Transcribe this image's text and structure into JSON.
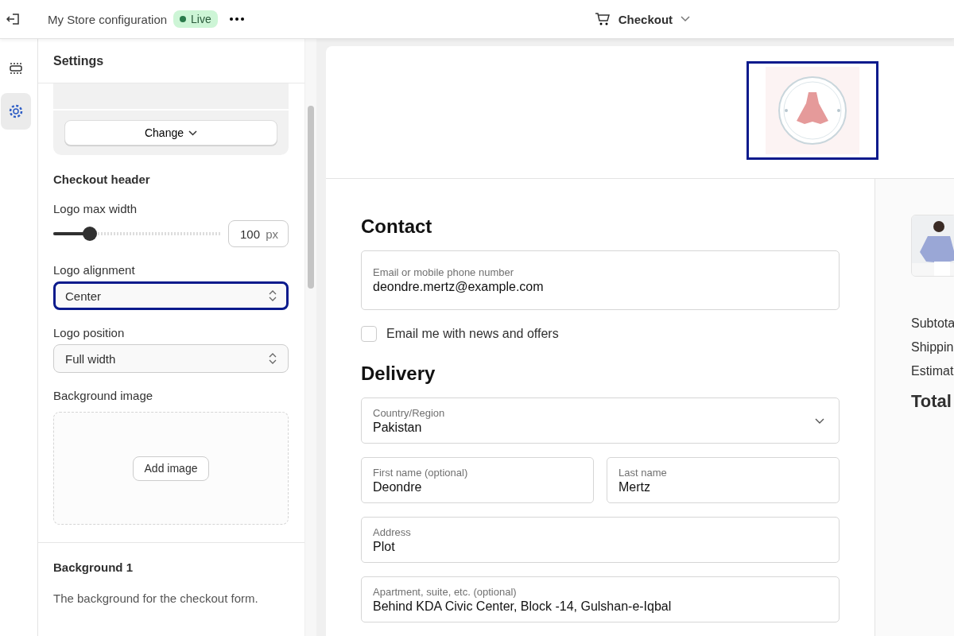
{
  "topbar": {
    "title": "My Store configuration",
    "status": "Live",
    "page": "Checkout"
  },
  "rail": [
    {
      "kind": "sections",
      "selected": false
    },
    {
      "kind": "settings",
      "selected": true
    }
  ],
  "settings": {
    "title": "Settings",
    "change_button": "Change",
    "section": "Checkout header",
    "max_width": {
      "label": "Logo max width",
      "level": 0.22,
      "value": "100",
      "unit": "px"
    },
    "selects": [
      {
        "label": "Logo alignment",
        "value": "Center",
        "highlighted": true
      },
      {
        "label": "Logo position",
        "value": "Full width",
        "highlighted": false
      }
    ],
    "background_image": {
      "label": "Background image",
      "button": "Add image"
    },
    "background": {
      "title": "Background 1",
      "description": "The background for the checkout form."
    }
  },
  "preview": {
    "logo": {
      "highlighted": true
    },
    "contact": {
      "title": "Contact",
      "email": {
        "label": "Email or mobile phone number",
        "value": "deondre.mertz@example.com"
      },
      "news": {
        "label": "Email me with news and offers",
        "checked": false
      }
    },
    "delivery": {
      "title": "Delivery",
      "rows": [
        [
          {
            "label": "Country/Region",
            "value": "Pakistan",
            "kind": "dropdown"
          }
        ],
        [
          {
            "label": "First name (optional)",
            "value": "Deondre",
            "kind": "text"
          },
          {
            "label": "Last name",
            "value": "Mertz",
            "kind": "text"
          }
        ],
        [
          {
            "label": "Address",
            "value": "Plot",
            "kind": "text"
          }
        ],
        [
          {
            "label": "Apartment, suite, etc. (optional)",
            "value": "Behind KDA Civic Center, Block -14, Gulshan-e-Iqbal",
            "kind": "text"
          }
        ]
      ]
    },
    "summary": {
      "lines": [
        "Subtota",
        "Shippin",
        "Estimat"
      ],
      "total": "Total"
    }
  }
}
